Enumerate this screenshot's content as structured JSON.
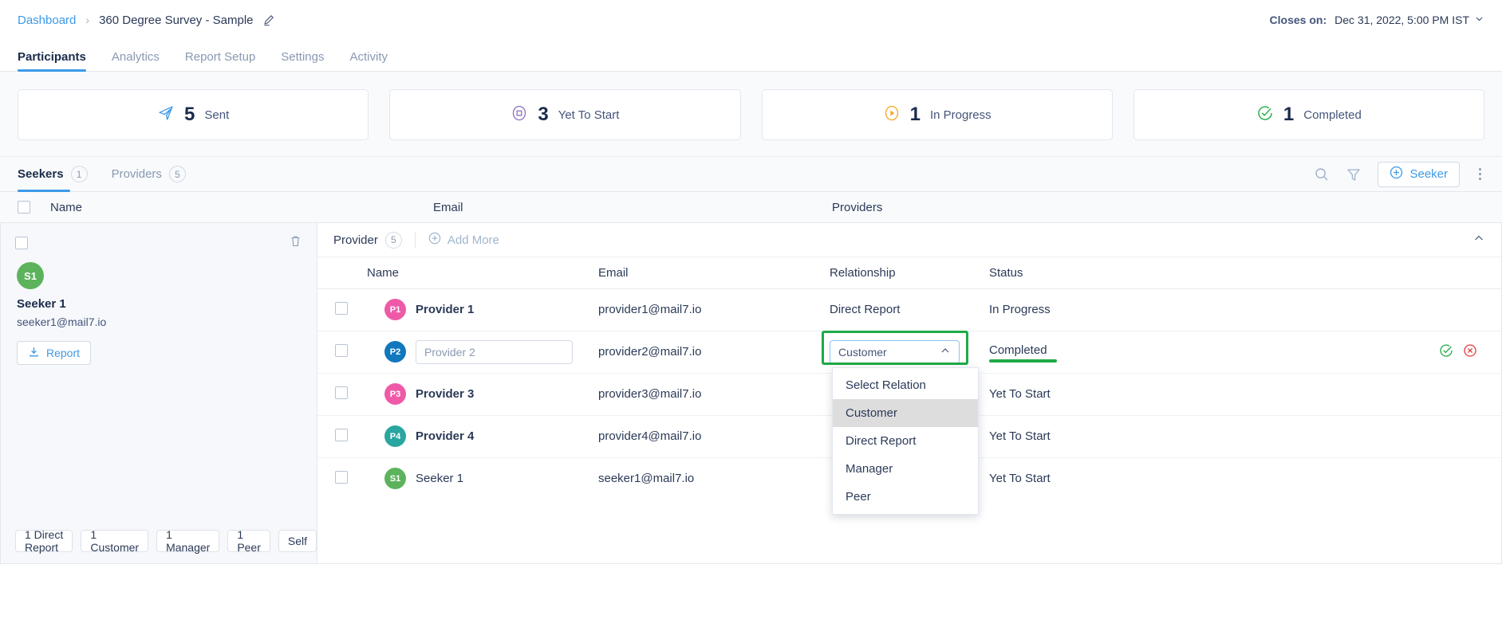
{
  "breadcrumb": {
    "root": "Dashboard",
    "separator": "›",
    "current": "360 Degree Survey - Sample"
  },
  "header": {
    "closes_label": "Closes on:",
    "closes_value": "Dec 31, 2022, 5:00 PM IST"
  },
  "tabs": [
    {
      "label": "Participants",
      "active": true
    },
    {
      "label": "Analytics",
      "active": false
    },
    {
      "label": "Report Setup",
      "active": false
    },
    {
      "label": "Settings",
      "active": false
    },
    {
      "label": "Activity",
      "active": false
    }
  ],
  "stats": [
    {
      "value": "5",
      "label": "Sent",
      "icon": "send-icon",
      "color": "#3d9ae8"
    },
    {
      "value": "3",
      "label": "Yet To Start",
      "icon": "circle-dot-icon",
      "color": "#8d6fc0"
    },
    {
      "value": "1",
      "label": "In Progress",
      "icon": "play-circle-icon",
      "color": "#f5a623"
    },
    {
      "value": "1",
      "label": "Completed",
      "icon": "check-circle-icon",
      "color": "#1faa46"
    }
  ],
  "subtabs": [
    {
      "label": "Seekers",
      "count": "1",
      "active": true
    },
    {
      "label": "Providers",
      "count": "5",
      "active": false
    }
  ],
  "toolbar": {
    "search_icon": "search-icon",
    "filter_icon": "filter-icon",
    "add_seeker_label": "Seeker",
    "more_icon": "kebab-icon"
  },
  "columns": {
    "name": "Name",
    "email": "Email",
    "providers": "Providers"
  },
  "seeker": {
    "initials": "S1",
    "avatar_color": "#5cb35c",
    "name": "Seeker 1",
    "email": "seeker1@mail7.io",
    "report_label": "Report",
    "relation_pills": [
      "1 Direct Report",
      "1 Customer",
      "1 Manager",
      "1 Peer",
      "Self"
    ]
  },
  "provider_panel": {
    "title": "Provider",
    "count": "5",
    "add_more_label": "Add More",
    "headers": {
      "name": "Name",
      "email": "Email",
      "relationship": "Relationship",
      "status": "Status"
    },
    "rows": [
      {
        "initials": "P1",
        "avatar_color": "#ef5aa8",
        "name": "Provider 1",
        "email": "provider1@mail7.io",
        "relationship": "Direct Report",
        "status": "In Progress",
        "editing": false
      },
      {
        "initials": "P2",
        "avatar_color": "#1178bd",
        "name": "",
        "name_placeholder": "Provider 2",
        "email": "provider2@mail7.io",
        "relationship": "Customer",
        "status": "Completed",
        "editing": true
      },
      {
        "initials": "P3",
        "avatar_color": "#ef5aa8",
        "name": "Provider 3",
        "email": "provider3@mail7.io",
        "relationship": "",
        "status": "Yet To Start",
        "editing": false
      },
      {
        "initials": "P4",
        "avatar_color": "#2aa6a1",
        "name": "Provider 4",
        "email": "provider4@mail7.io",
        "relationship": "",
        "status": "Yet To Start",
        "editing": false
      },
      {
        "initials": "S1",
        "avatar_color": "#5cb35c",
        "name": "Seeker 1",
        "email": "seeker1@mail7.io",
        "relationship": "",
        "status": "Yet To Start",
        "editing": false
      }
    ]
  },
  "relationship_dropdown": {
    "selected": "Customer",
    "open": true,
    "options": [
      "Select Relation",
      "Customer",
      "Direct Report",
      "Manager",
      "Peer"
    ],
    "highlighted": "Customer",
    "highlight_border_color": "#1faa46"
  },
  "row_actions": {
    "confirm_icon": "check-circle-icon",
    "cancel_icon": "cancel-circle-icon",
    "confirm_color": "#1faa46",
    "cancel_color": "#e23b3b"
  }
}
